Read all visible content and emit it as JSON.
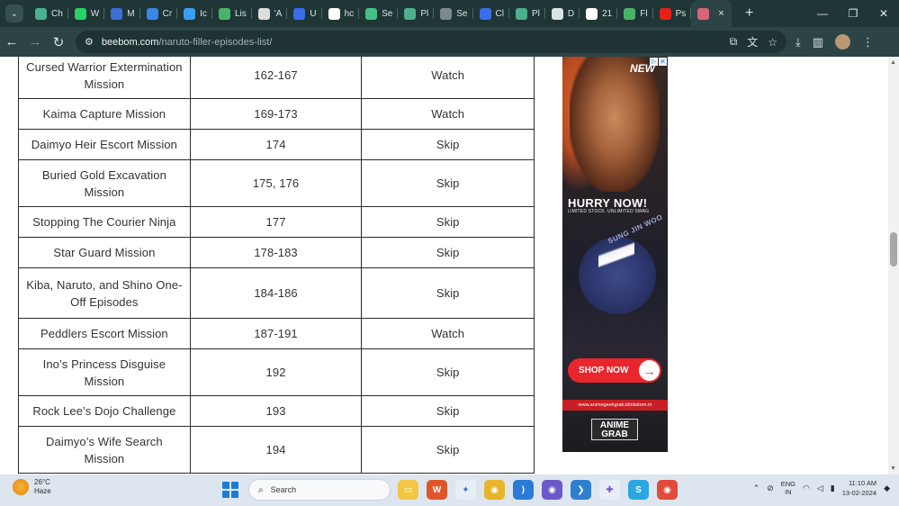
{
  "browser": {
    "tabs": [
      {
        "label": "Ch",
        "icon": "chatgpt-icon",
        "color": "#4bb08f"
      },
      {
        "label": "W",
        "icon": "whatsapp-icon",
        "color": "#25d366"
      },
      {
        "label": "M",
        "icon": "forms-icon",
        "color": "#3b6fd6"
      },
      {
        "label": "Cr",
        "icon": "chrome-icon",
        "color": "#3a87e8"
      },
      {
        "label": "Ic",
        "icon": "bolt-icon",
        "color": "#3a9ef0"
      },
      {
        "label": "Lis",
        "icon": "link-icon",
        "color": "#4ab36a"
      },
      {
        "label": "'A",
        "icon": "openai-icon",
        "color": "#dddddd"
      },
      {
        "label": "U",
        "icon": "copilot-icon",
        "color": "#3a6ee8"
      },
      {
        "label": "hc",
        "icon": "google-icon",
        "color": "#ffffff"
      },
      {
        "label": "Se",
        "icon": "vercel-icon",
        "color": "#44c189"
      },
      {
        "label": "Pl",
        "icon": "chatgpt-icon",
        "color": "#4bb08f"
      },
      {
        "label": "Se",
        "icon": "globe-icon",
        "color": "#7a8a8a"
      },
      {
        "label": "Cl",
        "icon": "copilot-icon",
        "color": "#3a6ee8"
      },
      {
        "label": "Pl",
        "icon": "chatgpt-icon",
        "color": "#4bb08f"
      },
      {
        "label": "D",
        "icon": "download-icon",
        "color": "#d8e4e3"
      },
      {
        "label": "21",
        "icon": "info-icon",
        "color": "#ffffff"
      },
      {
        "label": "Fl",
        "icon": "link-icon",
        "color": "#4ab36a"
      },
      {
        "label": "Ps",
        "icon": "youtube-icon",
        "color": "#e62117"
      }
    ],
    "active_tab_close": "×",
    "new_tab": "+",
    "url_host": "beebom.com",
    "url_path": "/naruto-filler-episodes-list/"
  },
  "table": {
    "rows": [
      {
        "mission": "Cursed Warrior Extermination Mission",
        "episodes": "162-167",
        "verdict": "Watch"
      },
      {
        "mission": "Kaima Capture Mission",
        "episodes": "169-173",
        "verdict": "Watch"
      },
      {
        "mission": "Daimyo Heir Escort Mission",
        "episodes": "174",
        "verdict": "Skip"
      },
      {
        "mission": "Buried Gold Excavation Mission",
        "episodes": "175, 176",
        "verdict": "Skip"
      },
      {
        "mission": "Stopping The Courier Ninja",
        "episodes": "177",
        "verdict": "Skip"
      },
      {
        "mission": "Star Guard Mission",
        "episodes": "178-183",
        "verdict": "Skip"
      },
      {
        "mission": "Kiba, Naruto, and Shino One-Off Episodes",
        "episodes": "184-186",
        "verdict": "Skip"
      },
      {
        "mission": "Peddlers Escort Mission",
        "episodes": "187-191",
        "verdict": "Watch"
      },
      {
        "mission": "Ino’s Princess Disguise Mission",
        "episodes": "192",
        "verdict": "Skip"
      },
      {
        "mission": "Rock Lee’s Dojo Challenge",
        "episodes": "193",
        "verdict": "Skip"
      },
      {
        "mission": "Daimyo’s Wife Search Mission",
        "episodes": "194",
        "verdict": "Skip"
      }
    ]
  },
  "ad": {
    "badge": "NEW",
    "headline": "HURRY NOW!",
    "subline": "LIMITED STOCK. UNLIMITED SWAG",
    "brand": "SUNG JIN WOO",
    "cta": "SHOP NOW",
    "url": "www.animegeekgrab.blinkstore.in",
    "logo_line1": "ANIME",
    "logo_line2": "GRAB"
  },
  "taskbar": {
    "temperature": "26°C",
    "condition": "Haze",
    "search_placeholder": "Search",
    "lang_line1": "ENG",
    "lang_line2": "IN",
    "time": "11:10 AM",
    "date": "13-02-2024"
  }
}
